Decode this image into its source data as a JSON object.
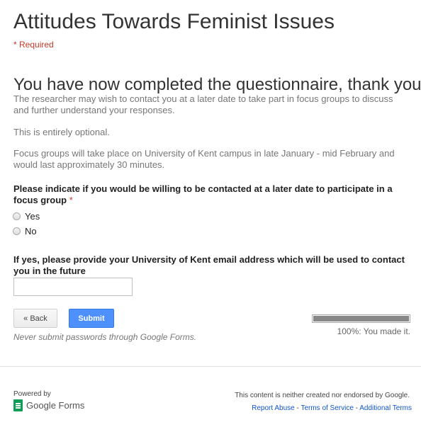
{
  "form": {
    "title": "Attitudes Towards Feminist Issues",
    "required_note": "* Required"
  },
  "section": {
    "title": "You have now completed the questionnaire, thank you!",
    "paragraph_1": "The researcher may wish to contact you at a later date to take part in focus groups to discuss and further understand your responses.",
    "paragraph_2": "This is entirely optional.",
    "paragraph_3": "Focus groups will take place on University of Kent campus in late January - mid February and would last approximately 30 minutes."
  },
  "question_contact": {
    "label": "Please indicate if you would be willing to be contacted at a later date to participate in a focus group",
    "required_mark": "*",
    "options": [
      "Yes",
      "No"
    ]
  },
  "question_email": {
    "label": "If yes, please provide your University of Kent email address which will be used to contact you in the future",
    "value": ""
  },
  "buttons": {
    "back_label": "« Back",
    "submit_label": "Submit"
  },
  "progress": {
    "percent": 100,
    "label": "100%: You made it."
  },
  "notices": {
    "password_warning": "Never submit passwords through Google Forms."
  },
  "footer": {
    "powered_by": "Powered by",
    "brand": "Google Forms",
    "disclaimer": "This content is neither created nor endorsed by Google.",
    "links": [
      "Report Abuse",
      "Terms of Service",
      "Additional Terms"
    ],
    "separator": " - "
  },
  "colors": {
    "required": "#c53929",
    "submit_button": "#4d90fe",
    "link": "#1155cc",
    "brand_green": "#0f9d58",
    "progress_fill": "#888888"
  },
  "icons": {
    "logo": "google-forms-icon",
    "radio": "radio-unchecked-icon"
  }
}
